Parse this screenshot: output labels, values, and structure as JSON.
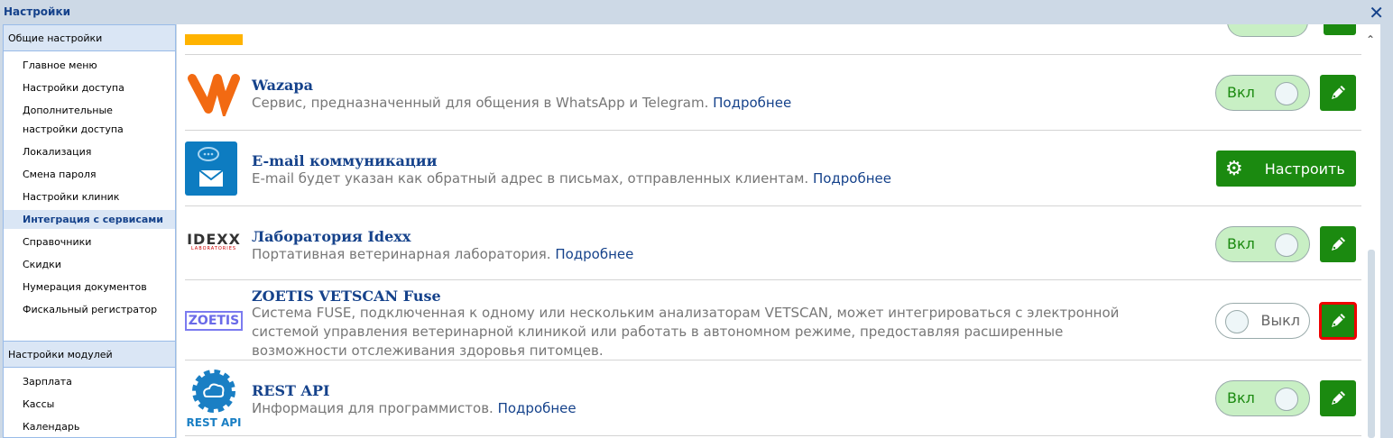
{
  "window": {
    "title": "Настройки",
    "close_icon": "close-icon"
  },
  "sidebar": {
    "section1": "Общие настройки",
    "items": [
      "Главное меню",
      "Настройки доступа",
      "Дополнительные настройки доступа",
      "Локализация",
      "Смена пароля",
      "Настройки клиник",
      "Интеграция с сервисами",
      "Справочники",
      "Скидки",
      "Нумерация документов",
      "Фискальный регистратор"
    ],
    "section2": "Настройки модулей",
    "items2": [
      "Зарплата",
      "Кассы",
      "Календарь"
    ]
  },
  "services": [
    {
      "title": "Wazapa",
      "desc": "Сервис, предназначенный для общения в WhatsApp и Telegram.",
      "link": "Подробнее",
      "state": "Вкл"
    },
    {
      "title": "E-mail коммуникации",
      "desc": "E-mail будет указан как обратный адрес в письмах, отправленных клиентам.",
      "link": "Подробнее",
      "button": "Настроить"
    },
    {
      "title": "Лаборатория Idexx",
      "desc": "Портативная ветеринарная лаборатория.",
      "link": "Подробнее",
      "state": "Вкл",
      "logo": "IDEXX",
      "logo_sub": "LABORATORIES"
    },
    {
      "title": "ZOETIS VETSCAN Fuse",
      "desc": "Система FUSE, подключенная к одному или нескольким анализаторам VETSCAN, может интегрироваться с электронной системой управления ветеринарной клиникой или работать в автономном режиме, предоставляя расширенные возможности отслеживания здоровья питомцев.",
      "state": "Выкл",
      "logo": "ZOETIS"
    },
    {
      "title": "REST API",
      "desc": "Информация для программистов.",
      "link": "Подробнее",
      "state": "Вкл",
      "logo": "REST API"
    }
  ],
  "colors": {
    "accent": "#1b8a10",
    "title": "#15428b",
    "toggle_on": "#c8efc4",
    "highlight": "#ee0000"
  }
}
